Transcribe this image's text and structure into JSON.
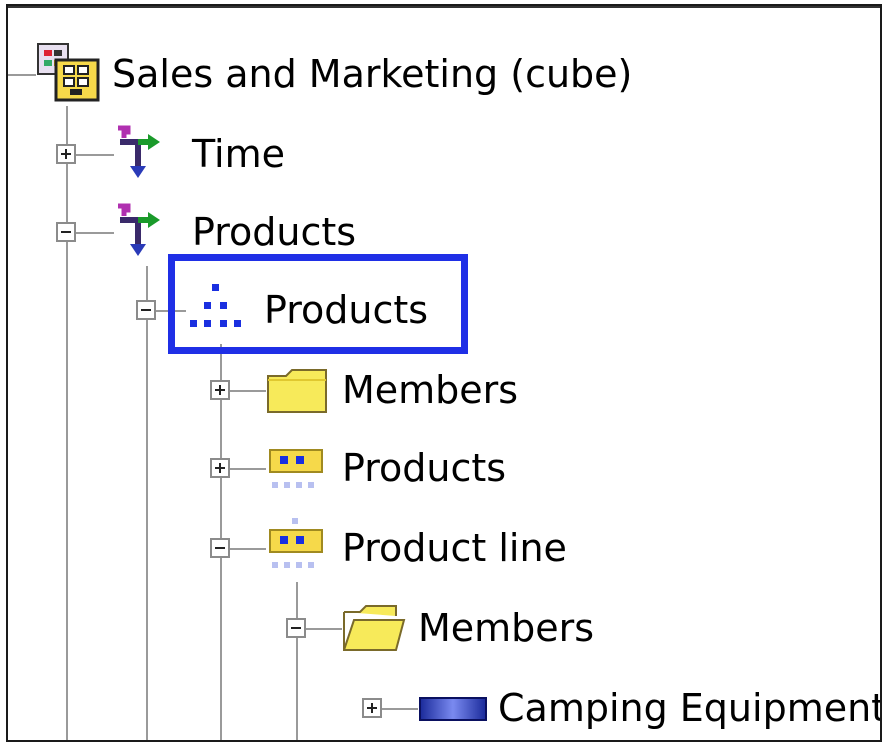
{
  "tree": {
    "root": {
      "label": "Sales and Marketing (cube)",
      "icon": "cube-icon"
    },
    "nodes": [
      {
        "label": "Time",
        "icon": "dimension-icon",
        "state": "collapsed"
      },
      {
        "label": "Products",
        "icon": "dimension-icon",
        "state": "expanded"
      },
      {
        "label": "Products",
        "icon": "hierarchy-icon",
        "state": "expanded",
        "highlighted": true
      },
      {
        "label": "Members",
        "icon": "folder-closed-icon",
        "state": "collapsed"
      },
      {
        "label": "Products",
        "icon": "level-icon",
        "state": "collapsed"
      },
      {
        "label": "Product line",
        "icon": "level-icon",
        "state": "expanded"
      },
      {
        "label": "Members",
        "icon": "folder-open-icon",
        "state": "expanded"
      },
      {
        "label": "Camping Equipment",
        "icon": "member-icon",
        "state": "collapsed"
      }
    ]
  },
  "colors": {
    "highlight": "#1f2fe6",
    "folder": "#f6e84a",
    "member": "#2a3fc8"
  }
}
